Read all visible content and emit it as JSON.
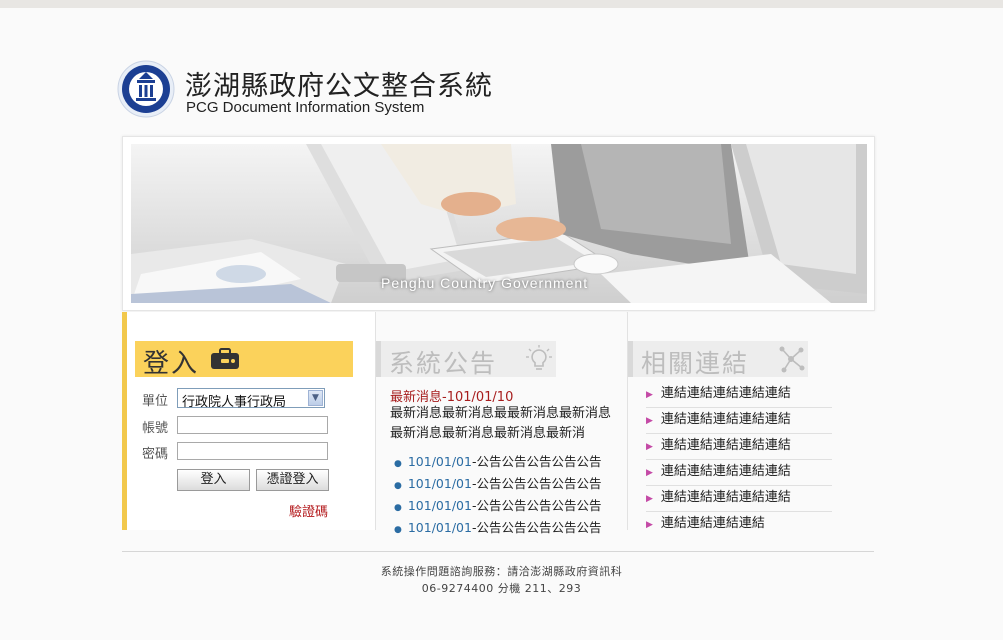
{
  "header": {
    "title_cn": "澎湖縣政府公文整合系統",
    "title_en": "PCG Document Information System"
  },
  "banner": {
    "caption": "Penghu Country Government"
  },
  "login": {
    "title": "登入",
    "unit_label": "單位",
    "unit_value": "行政院人事行政局",
    "account_label": "帳號",
    "password_label": "密碼",
    "login_button": "登入",
    "cert_login_button": "憑證登入",
    "verify_code_link": "驗證碼"
  },
  "news": {
    "title": "系統公告",
    "latest": "最新消息-101/01/10",
    "body": "最新消息最新消息最最新消息最新消息最新消息最新消息最新消息最新消",
    "notices": [
      {
        "date": "101/01/01",
        "text": "-公告公告公告公告公告"
      },
      {
        "date": "101/01/01",
        "text": "-公告公告公告公告公告"
      },
      {
        "date": "101/01/01",
        "text": "-公告公告公告公告公告"
      },
      {
        "date": "101/01/01",
        "text": "-公告公告公告公告公告"
      }
    ]
  },
  "links": {
    "title": "相關連結",
    "items": [
      "連結連結連結連結連結",
      "連結連結連結連結連結",
      "連結連結連結連結連結",
      "連結連結連結連結連結",
      "連結連結連結連結連結",
      "連結連結連結連結"
    ]
  },
  "footer": {
    "line1": "系統操作問題諮詢服務：請洽澎湖縣政府資訊科",
    "line2": "06-9274400 分機 211、293"
  },
  "colors": {
    "accent_yellow": "#fbd25b",
    "alert_red": "#b3181b",
    "link_blue": "#2b6ca3"
  }
}
